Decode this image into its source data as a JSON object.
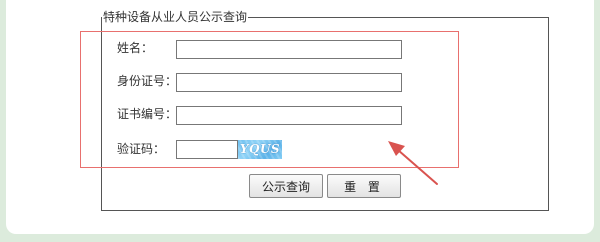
{
  "form": {
    "legend": "特种设备从业人员公示查询",
    "fields": [
      {
        "label": "姓名：",
        "value": "",
        "placeholder": ""
      },
      {
        "label": "身份证号：",
        "value": "",
        "placeholder": ""
      },
      {
        "label": "证书编号：",
        "value": "",
        "placeholder": ""
      }
    ],
    "captcha": {
      "label": "验证码：",
      "value": "",
      "image_text": "YQUS"
    },
    "buttons": {
      "query_label": "公示查询",
      "reset_label": "重 置"
    }
  },
  "annotation": {
    "highlight_color": "#e8706e",
    "arrow_color": "#d9534f"
  }
}
